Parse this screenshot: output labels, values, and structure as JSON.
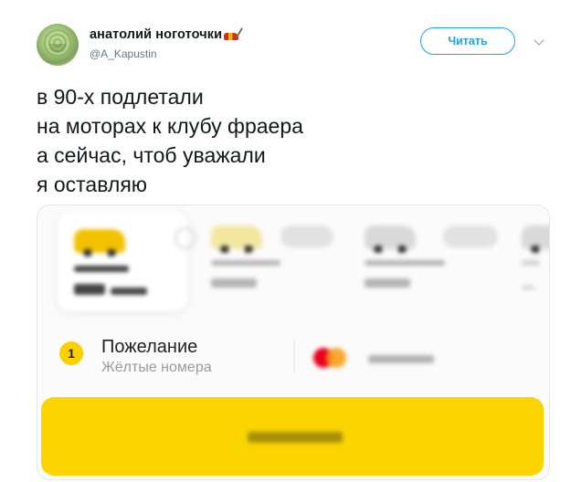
{
  "tweet": {
    "user_name": "анатолий ноготочки",
    "handle": "@A_Kapustin",
    "follow_label": "Читать",
    "text_lines": [
      "в 90-х подлетали",
      "на моторах к клубу фраера",
      "а сейчас, чтоб уважали",
      "я оставляю"
    ]
  },
  "media": {
    "wish_number": "1",
    "wish_title": "Пожелание",
    "wish_value": "Жёлтые номера"
  },
  "colors": {
    "twitter_blue": "#1da1f2",
    "taxi_yellow": "#fcd500",
    "mastercard_red": "#eb001b",
    "mastercard_orange": "#f79e1b"
  }
}
